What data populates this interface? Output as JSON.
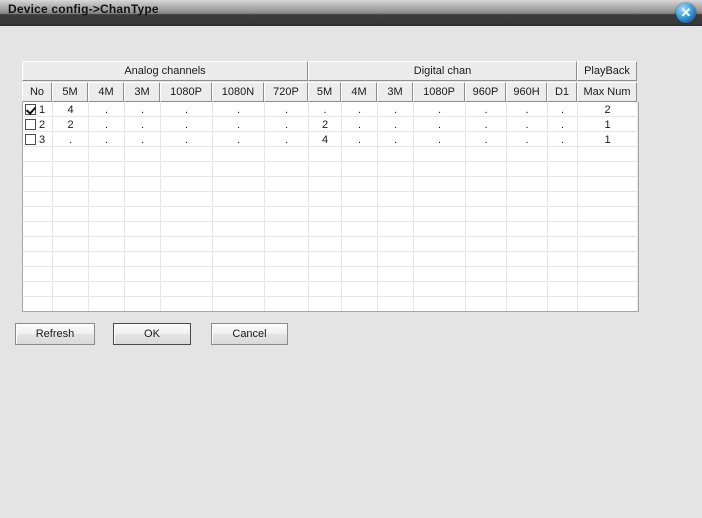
{
  "window": {
    "title": "Device config->ChanType",
    "close_icon": "close-icon",
    "close_glyph": "✕",
    "accent_color": "#1b72b8",
    "background_color": "#e4e4e4",
    "titlebar_text_color": "#111111"
  },
  "table": {
    "groups": [
      {
        "label": "Analog channels",
        "span": 7
      },
      {
        "label": "Digital chan",
        "span": 7
      },
      {
        "label": "PlayBack",
        "span": 1
      }
    ],
    "columns": [
      "No",
      "5M",
      "4M",
      "3M",
      "1080P",
      "1080N",
      "720P",
      "5M",
      "4M",
      "3M",
      "1080P",
      "960P",
      "960H",
      "D1",
      "Max Num"
    ],
    "rows": [
      {
        "checked": true,
        "no": "1",
        "values": [
          "4",
          ".",
          ".",
          ".",
          ".",
          ".",
          ".",
          ".",
          ".",
          ".",
          ".",
          ".",
          ".",
          "2"
        ]
      },
      {
        "checked": false,
        "no": "2",
        "values": [
          "2",
          ".",
          ".",
          ".",
          ".",
          ".",
          "2",
          ".",
          ".",
          ".",
          ".",
          ".",
          ".",
          "1"
        ]
      },
      {
        "checked": false,
        "no": "3",
        "values": [
          ".",
          ".",
          ".",
          ".",
          ".",
          ".",
          "4",
          ".",
          ".",
          ".",
          ".",
          ".",
          ".",
          "1"
        ]
      }
    ],
    "empty_row_count": 11
  },
  "buttons": {
    "refresh": "Refresh",
    "ok": "OK",
    "cancel": "Cancel"
  }
}
